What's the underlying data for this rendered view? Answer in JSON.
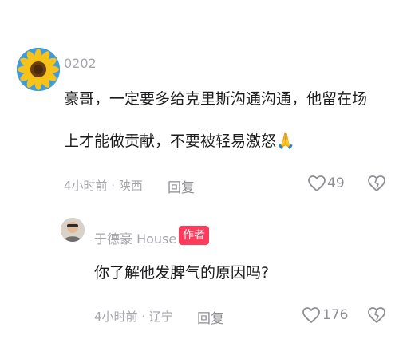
{
  "comment": {
    "username": "0202",
    "line1": "豪哥，一定要多给克里斯沟通沟通，他留在场",
    "line2": "上才能做贡献，不要被轻易激怒",
    "emoji": "🙏",
    "meta": "4小时前 · 陕西",
    "reply_label": "回复",
    "like_count": "49"
  },
  "reply": {
    "username": "于德豪 House",
    "author_tag": "作者",
    "text": "你了解他发脾气的原因吗?",
    "meta": "4小时前 · 辽宁",
    "reply_label": "回复",
    "like_count": "176"
  },
  "colors": {
    "author_tag": "#ff3b5c",
    "text": "#1c1c1e",
    "muted": "#a5a5ab"
  },
  "icons": [
    "heart-outline-icon",
    "broken-heart-icon",
    "sunflower-avatar",
    "person-avatar"
  ]
}
